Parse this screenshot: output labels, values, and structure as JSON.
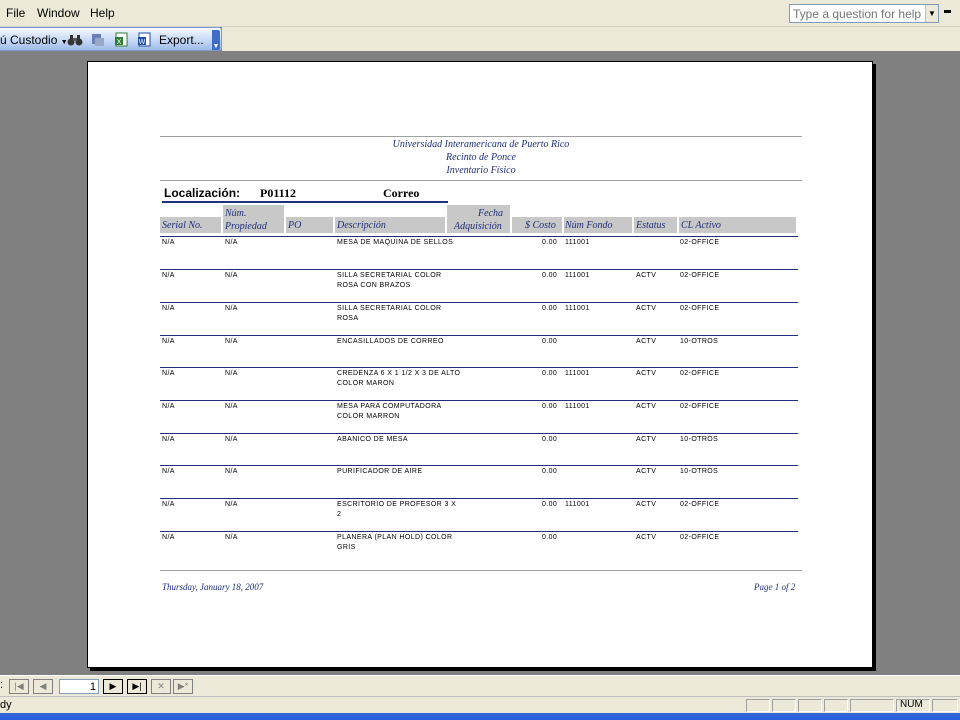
{
  "menu": {
    "items": [
      "File",
      "Window",
      "Help"
    ]
  },
  "help_box": {
    "placeholder": "Type a question for help"
  },
  "toolbar": {
    "view_label": "ú Custodio",
    "export_label": "Export..."
  },
  "report": {
    "header": [
      "Universidad Interamericana de Puerto Rico",
      "Recinto de Ponce",
      "Inventario Físico"
    ],
    "location": {
      "label": "Localización:",
      "code": "P01112",
      "name": "Correo"
    },
    "columns": {
      "serial": "Serial No.",
      "prop_1": "Núm.",
      "prop_2": "Propiedad",
      "po": "PO",
      "desc": "Descripción",
      "fecha_1": "Fecha",
      "fecha_2": "Adquisición",
      "costo": "$ Costo",
      "fondo": "Núm Fondo",
      "estatus": "Estatus",
      "cl": "CL Activo"
    },
    "rows": [
      {
        "serial": "N/A",
        "prop": "N/A",
        "desc": "MESA DE MAQUINA DE SELLOS",
        "cost": "0.00",
        "fondo": "111001",
        "estatus": "",
        "cl": "02-OFFICE"
      },
      {
        "serial": "N/A",
        "prop": "N/A",
        "desc": "SILLA SECRETARIAL COLOR ROSA CON BRAZOS",
        "cost": "0.00",
        "fondo": "111001",
        "estatus": "ACTV",
        "cl": "02-OFFICE"
      },
      {
        "serial": "N/A",
        "prop": "N/A",
        "desc": "SILLA SECRETARIAL COLOR ROSA",
        "cost": "0.00",
        "fondo": "111001",
        "estatus": "ACTV",
        "cl": "02-OFFICE"
      },
      {
        "serial": "N/A",
        "prop": "N/A",
        "desc": "ENCASILLADOS DE CORREO",
        "cost": "0.00",
        "fondo": "",
        "estatus": "ACTV",
        "cl": "10-OTROS"
      },
      {
        "serial": "N/A",
        "prop": "N/A",
        "desc": "CREDENZA 6 X 1 1/2 X 3 DE ALTO COLOR MARON",
        "cost": "0.00",
        "fondo": "111001",
        "estatus": "ACTV",
        "cl": "02-OFFICE"
      },
      {
        "serial": "N/A",
        "prop": "N/A",
        "desc": "MESA PARA COMPUTADORA COLOR MARRON",
        "cost": "0.00",
        "fondo": "111001",
        "estatus": "ACTV",
        "cl": "02-OFFICE"
      },
      {
        "serial": "N/A",
        "prop": "N/A",
        "desc": "ABANICO DE MESA",
        "cost": "0.00",
        "fondo": "",
        "estatus": "ACTV",
        "cl": "10-OTROS"
      },
      {
        "serial": "N/A",
        "prop": "N/A",
        "desc": "PURIFICADOR DE AIRE",
        "cost": "0.00",
        "fondo": "",
        "estatus": "ACTV",
        "cl": "10-OTROS"
      },
      {
        "serial": "N/A",
        "prop": "N/A",
        "desc": "ESCRITORIO DE PROFESOR 3 X 2",
        "cost": "0.00",
        "fondo": "111001",
        "estatus": "ACTV",
        "cl": "02-OFFICE"
      },
      {
        "serial": "N/A",
        "prop": "N/A",
        "desc": "PLANERA (PLAN HOLD) COLOR GRIS",
        "cost": "0.00",
        "fondo": "",
        "estatus": "ACTV",
        "cl": "02-OFFICE"
      }
    ],
    "footer": {
      "date": "Thursday, January 18, 2007",
      "page": "Page 1 of 2"
    }
  },
  "nav": {
    "label": ":",
    "page_value": "1"
  },
  "status": {
    "left": "dy",
    "num": "NUM"
  },
  "colors": {
    "report_blue": "#1f2f7a",
    "header_gray": "#c8c8c8",
    "workspace": "#808080",
    "chrome": "#ece9d8"
  },
  "icons": [
    "binoculars-icon",
    "merge-icon",
    "excel-icon",
    "word-icon",
    "first-record-icon",
    "prev-record-icon",
    "next-record-icon",
    "last-record-icon",
    "new-record-icon"
  ]
}
